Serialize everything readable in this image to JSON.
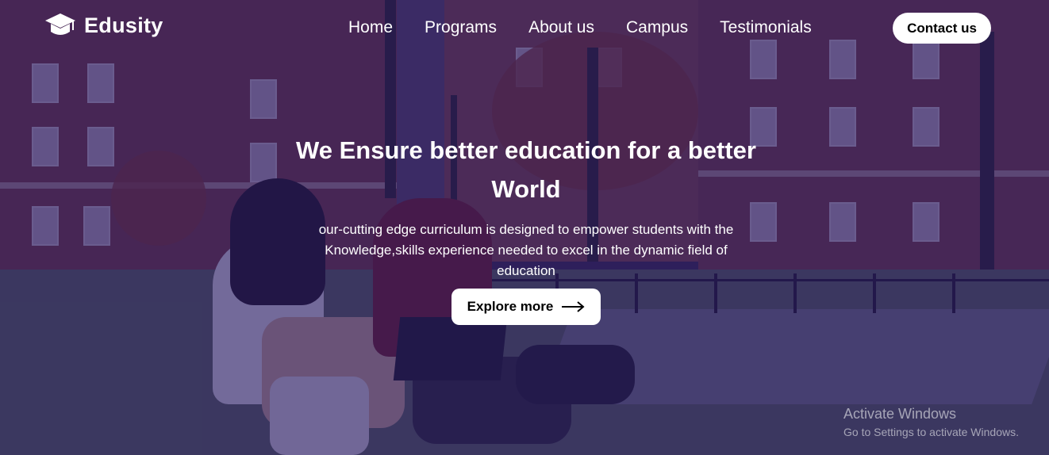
{
  "brand": {
    "name": "Edusity",
    "icon": "graduation-cap-icon"
  },
  "nav": {
    "items": [
      {
        "label": "Home"
      },
      {
        "label": "Programs"
      },
      {
        "label": "About us"
      },
      {
        "label": "Campus"
      },
      {
        "label": "Testimonials"
      }
    ],
    "contact_label": "Contact us"
  },
  "hero": {
    "title_line1": "We Ensure better education for a better",
    "title_line2": "World",
    "subtitle_line1": "our-cutting edge curriculum is designed to empower students with the",
    "subtitle_line2": "Knowledge,skills experience needed to excel in the dynamic field of",
    "subtitle_line3": "education",
    "cta_label": "Explore more",
    "cta_icon": "arrow-right-icon"
  },
  "watermark": {
    "title": "Activate Windows",
    "subtitle": "Go to Settings to activate Windows."
  },
  "colors": {
    "overlay": "#261964",
    "button_bg": "#ffffff",
    "text": "#ffffff"
  }
}
